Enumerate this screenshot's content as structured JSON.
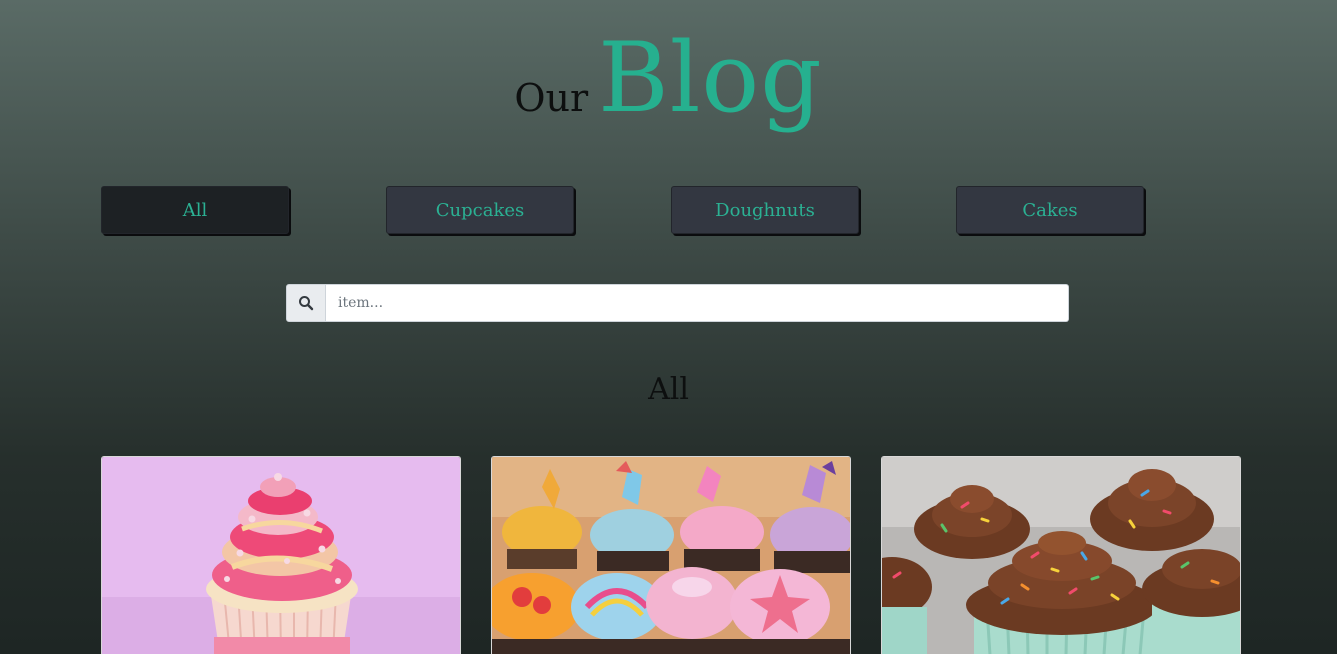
{
  "header": {
    "title_prefix": "Our",
    "title_main": "Blog"
  },
  "filters": [
    {
      "label": "All",
      "active": true
    },
    {
      "label": "Cupcakes",
      "active": false
    },
    {
      "label": "Doughnuts",
      "active": false
    },
    {
      "label": "Cakes",
      "active": false
    }
  ],
  "search": {
    "icon": "search-icon",
    "placeholder": "item...",
    "value": ""
  },
  "section": {
    "heading": "All"
  },
  "cards": [
    {
      "image": "pink-cupcake-photo"
    },
    {
      "image": "pony-cupcakes-photo"
    },
    {
      "image": "chocolate-cupcakes-photo"
    }
  ],
  "colors": {
    "accent": "#26b08f",
    "button_bg": "#333741",
    "button_active_bg": "#1d2124"
  }
}
